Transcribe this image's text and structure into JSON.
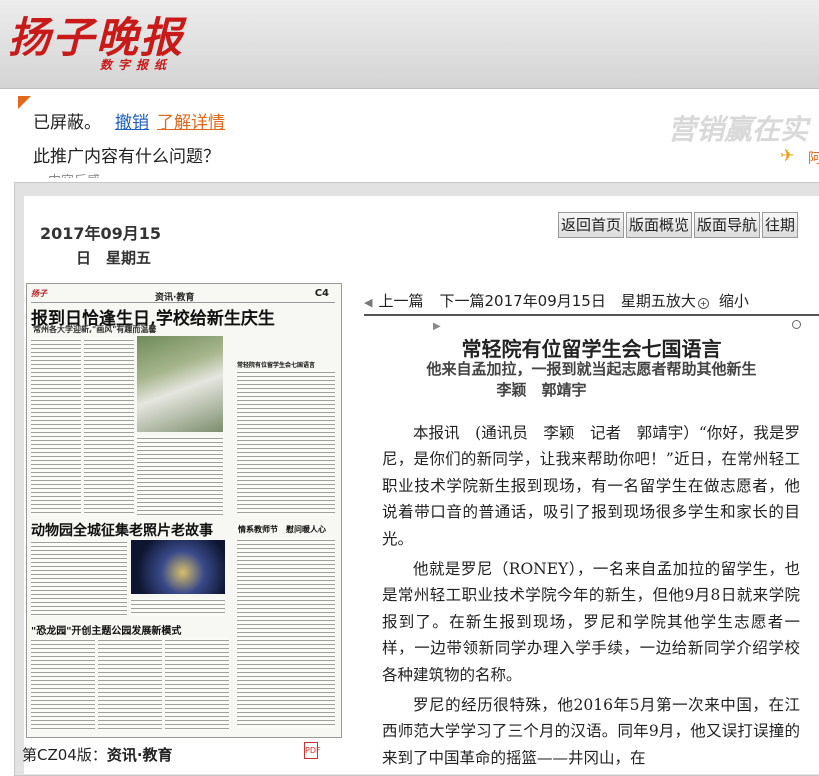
{
  "header": {
    "logo_text": "扬子晚报",
    "logo_subtitle": "数字报纸"
  },
  "ad": {
    "blocked_text": "已屏蔽。",
    "undo_label": "撤销",
    "details_label": "了解详情",
    "question_text": "此推广内容有什么问题？",
    "partial_text": "内容反感",
    "brand_text": "营销赢在实",
    "brand_small": "阿"
  },
  "edition": {
    "date_line1": "2017年09月15",
    "date_line2": "日　星期五"
  },
  "nav": {
    "home_label": "返回首页",
    "overview_label": "版面概览",
    "navigation_label": "版面导航",
    "past_label": "往期"
  },
  "page_thumb": {
    "paper_logo": "扬子",
    "paper_section": "资讯·教育",
    "paper_page": "C4",
    "headline1": "报到日恰逢生日,学校给新生庆生",
    "sub1": "常州各大学迎新,\"画风\"有趣而温馨",
    "side_title": "常轻院有位留学生会七国语言",
    "headline2": "动物园全城征集老照片老故事",
    "box_title": "情系教师节　慰问暖人心",
    "headline3": "\"恐龙园\"开创主题公园发展新模式",
    "caption_prefix": "第CZ04版：",
    "caption_section": "资讯·教育",
    "pdf_icon": "PDF"
  },
  "article_nav": {
    "prev_label": "上一篇",
    "next_label": "下一篇",
    "date_text": "2017年09月15日　星期五",
    "zoom_in_label": "放大",
    "zoom_out_label": "缩小"
  },
  "article": {
    "title": "常轻院有位留学生会七国语言",
    "subtitle": "他来自孟加拉，一报到就当起志愿者帮助其他新生",
    "authors": "李颖　郭靖宇",
    "paragraphs": [
      "本报讯　(通讯员　李颖　记者　郭靖宇）“你好，我是罗尼，是你们的新同学，让我来帮助你吧！”近日，在常州轻工职业技术学院新生报到现场，有一名留学生在做志愿者，他说着带口音的普通话，吸引了报到现场很多学生和家长的目光。",
      "他就是罗尼（RONEY），一名来自孟加拉的留学生，也是常州轻工职业技术学院今年的新生，但他9月8日就来学院报到了。在新生报到现场，罗尼和学院其他学生志愿者一样，一边带领新同学办理入学手续，一边给新同学介绍学校各种建筑物的名称。",
      "罗尼的经历很特殊，他2016年5月第一次来中国，在江西师范大学学习了三个月的汉语。同年9月，他又误打误撞的来到了中国革命的摇篮——井冈山，在"
    ]
  }
}
